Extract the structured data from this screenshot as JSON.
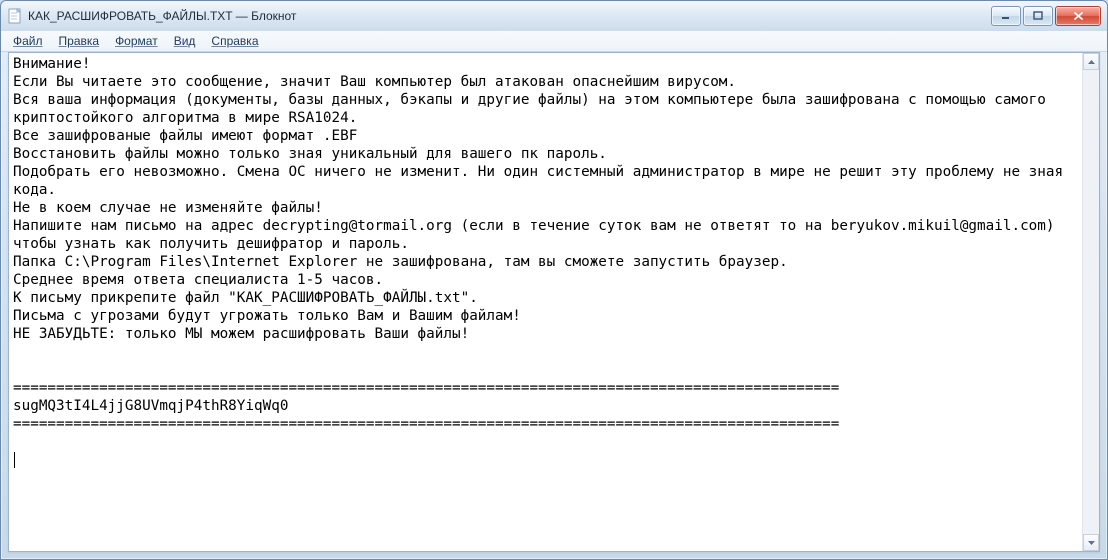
{
  "window": {
    "title": "КАК_РАСШИФРОВАТЬ_ФАЙЛЫ.TXT — Блокнот"
  },
  "menu": {
    "file": "Файл",
    "edit": "Правка",
    "format": "Формат",
    "view": "Вид",
    "help": "Справка"
  },
  "content": "Внимание!\nЕсли Вы читаете это сообщение, значит Ваш компьютер был атакован опаснейшим вирусом.\nВся ваша информация (документы, базы данных, бэкапы и другие файлы) на этом компьютере была зашифрована с помощью самого криптостойкого алгоритма в мире RSA1024.\nВсе зашифрованые файлы имеют формат .EBF\nВосстановить файлы можно только зная уникальный для вашего пк пароль.\nПодобрать его невозможно. Смена ОС ничего не изменит. Ни один системный администратор в мире не решит эту проблему не зная кода.\nНе в коем случае не изменяйте файлы!\nНапишите нам письмо на адрес decrypting@tormail.org (если в течение суток вам не ответят то на beryukov.mikuil@gmail.com) чтобы узнать как получить дешифратор и пароль.\nПапка C:\\Program Files\\Internet Explorer не зашифрована, там вы сможете запустить браузер.\nСреднее время ответа специалиста 1-5 часов.\nК письму прикрепите файл \"КАК_РАСШИФРОВАТЬ_ФАЙЛЫ.txt\".\nПисьма с угрозами будут угрожать только Вам и Вашим файлам!\nНЕ ЗАБУДЬТЕ: только МЫ можем расшифровать Ваши файлы!\n\n\n================================================================================================\nsugMQ3tI4L4jjG8UVmqjP4thR8YiqWq0\n================================================================================================\n\n"
}
